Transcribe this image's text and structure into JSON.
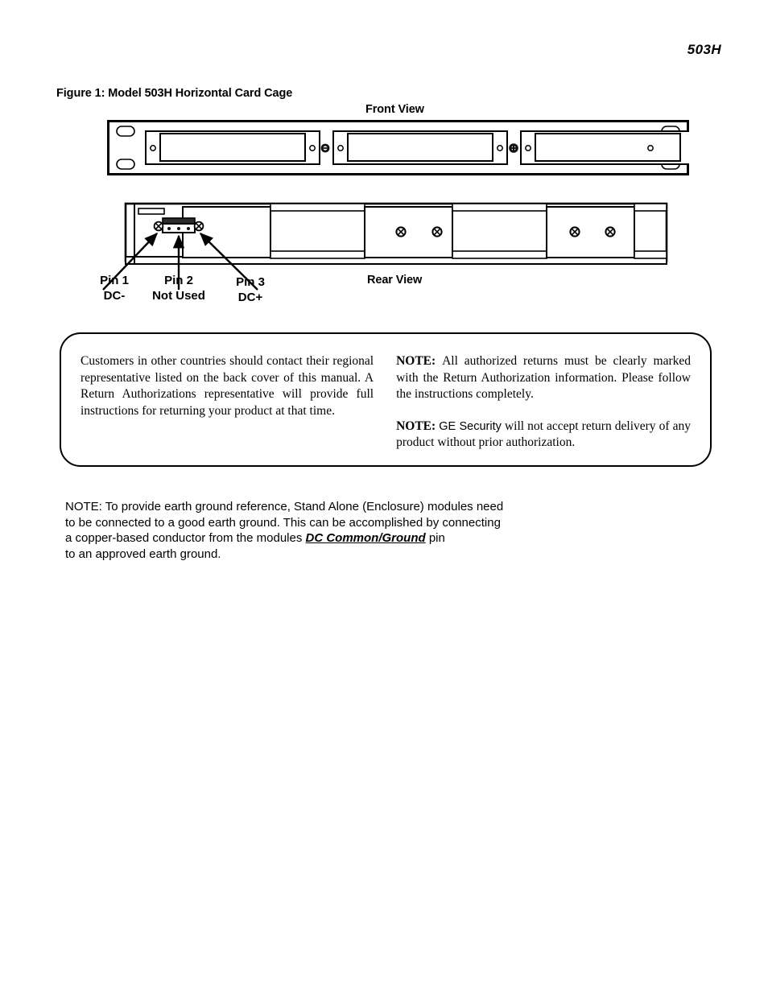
{
  "page": {
    "running_header": "503H"
  },
  "figure": {
    "caption": "Figure 1: Model 503H Horizontal Card Cage",
    "front_view_label": "Front View",
    "rear_view_label": "Rear View",
    "callouts": [
      {
        "name": "Pin 1",
        "function": "DC-"
      },
      {
        "name": "Pin 2",
        "function": "Not Used"
      },
      {
        "name": "Pin 3",
        "function": "DC+"
      }
    ]
  },
  "return_note": {
    "left_paragraph": "Customers in other countries should contact their regional representative listed on the back cover of this manual. A Return Authorizations representative will provide full instructions for returning your product at that time.",
    "notes": [
      {
        "keyword": "NOTE:",
        "text": "All authorized returns must be clearly marked with the Return Authorization information. Please follow the instructions completely."
      },
      {
        "keyword": "NOTE:",
        "brand": "GE Security",
        "text_before_brand": "",
        "text_after_brand": " will not accept return delivery of any product without prior authorization."
      }
    ]
  },
  "ground_note": {
    "line1": "NOTE: To provide earth ground reference, Stand Alone (Enclosure) modules need",
    "line2": "to be connected to a good earth ground. This can be accomplished by connecting",
    "line3_before": "a copper-based conductor from the modules ",
    "line3_emphasis": "DC Common/Ground",
    "line3_after": " pin",
    "line4": "to an approved earth ground."
  },
  "colors": {
    "ink": "#000000",
    "paper": "#ffffff",
    "panel_fill": "#ffffff",
    "screw_dark": "#1a1a1a"
  }
}
